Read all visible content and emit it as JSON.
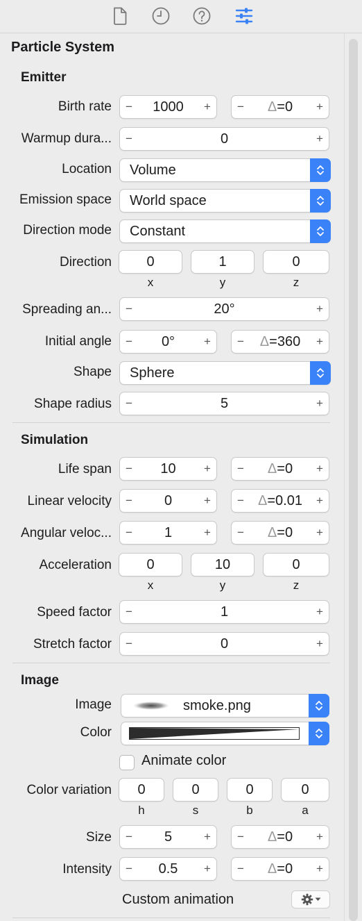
{
  "tabs": [
    {
      "icon": "document-icon"
    },
    {
      "icon": "clock-icon"
    },
    {
      "icon": "help-icon"
    },
    {
      "icon": "sliders-icon",
      "active": true
    }
  ],
  "accent_color": "#3a82f7",
  "panel_title": "Particle System",
  "emitter": {
    "title": "Emitter",
    "birth_rate": {
      "label": "Birth rate",
      "value": "1000",
      "delta_symbol": "Δ",
      "delta": "=0"
    },
    "warmup": {
      "label": "Warmup dura...",
      "value": "0"
    },
    "location": {
      "label": "Location",
      "value": "Volume"
    },
    "emission_space": {
      "label": "Emission space",
      "value": "World space"
    },
    "direction_mode": {
      "label": "Direction mode",
      "value": "Constant"
    },
    "direction": {
      "label": "Direction",
      "x": "0",
      "y": "1",
      "z": "0",
      "x_label": "x",
      "y_label": "y",
      "z_label": "z"
    },
    "spreading": {
      "label": "Spreading an...",
      "value": "20°"
    },
    "initial_angle": {
      "label": "Initial angle",
      "value": "0°",
      "delta_symbol": "Δ",
      "delta": "=360"
    },
    "shape": {
      "label": "Shape",
      "value": "Sphere"
    },
    "shape_radius": {
      "label": "Shape radius",
      "value": "5"
    }
  },
  "simulation": {
    "title": "Simulation",
    "life_span": {
      "label": "Life span",
      "value": "10",
      "delta_symbol": "Δ",
      "delta": "=0"
    },
    "linear_velocity": {
      "label": "Linear velocity",
      "value": "0",
      "delta_symbol": "Δ",
      "delta": "=0.01"
    },
    "angular_velocity": {
      "label": "Angular veloc...",
      "value": "1",
      "delta_symbol": "Δ",
      "delta": "=0"
    },
    "acceleration": {
      "label": "Acceleration",
      "x": "0",
      "y": "10",
      "z": "0",
      "x_label": "x",
      "y_label": "y",
      "z_label": "z"
    },
    "speed_factor": {
      "label": "Speed factor",
      "value": "1"
    },
    "stretch_factor": {
      "label": "Stretch factor",
      "value": "0"
    }
  },
  "image": {
    "title": "Image",
    "image": {
      "label": "Image",
      "value": "smoke.png"
    },
    "color": {
      "label": "Color"
    },
    "animate_color": {
      "label": "Animate color",
      "checked": false
    },
    "color_variation": {
      "label": "Color variation",
      "h": "0",
      "s": "0",
      "b": "0",
      "a": "0",
      "h_label": "h",
      "s_label": "s",
      "b_label": "b",
      "a_label": "a"
    },
    "size": {
      "label": "Size",
      "value": "5",
      "delta_symbol": "Δ",
      "delta": "=0"
    },
    "intensity": {
      "label": "Intensity",
      "value": "0.5",
      "delta_symbol": "Δ",
      "delta": "=0"
    },
    "custom_animation": {
      "label": "Custom animation"
    }
  },
  "stepper_minus": "−",
  "stepper_plus": "+"
}
